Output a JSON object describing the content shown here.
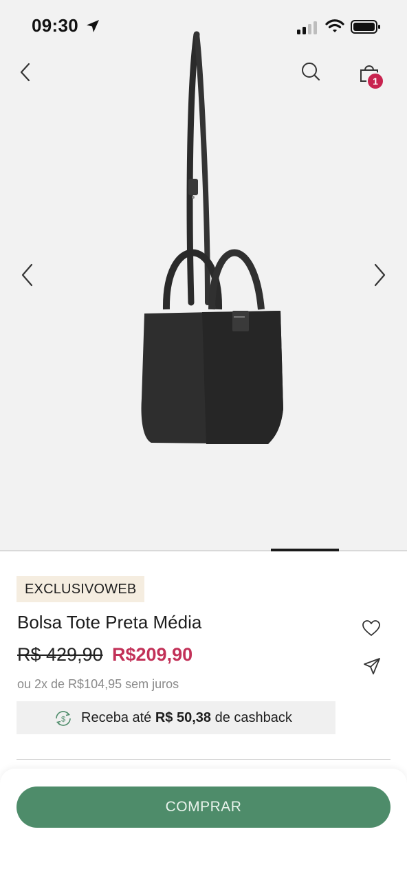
{
  "status_bar": {
    "time": "09:30"
  },
  "header": {
    "cart_count": "1"
  },
  "product": {
    "tag": "EXCLUSIVOWEB",
    "title": "Bolsa Tote Preta Média",
    "price_old": "R$ 429,90",
    "price_new": "R$209,90",
    "installments": "ou 2x de R$104,95 sem juros",
    "cashback_prefix": "Receba até",
    "cashback_amount": "R$ 50,38",
    "cashback_suffix": "de cashback"
  },
  "actions": {
    "buy_label": "COMPRAR"
  },
  "colors": {
    "accent_price": "#c23158",
    "badge": "#c8234f",
    "buy_button": "#4e8c6a",
    "tag_bg": "#f5ede0",
    "hero_bg": "#f2f2f2"
  },
  "icons": [
    "location-arrow-icon",
    "signal-icon",
    "wifi-icon",
    "battery-icon",
    "back-icon",
    "search-icon",
    "shopping-bag-icon",
    "chevron-left-icon",
    "chevron-right-icon",
    "heart-icon",
    "share-icon",
    "cashback-icon"
  ]
}
